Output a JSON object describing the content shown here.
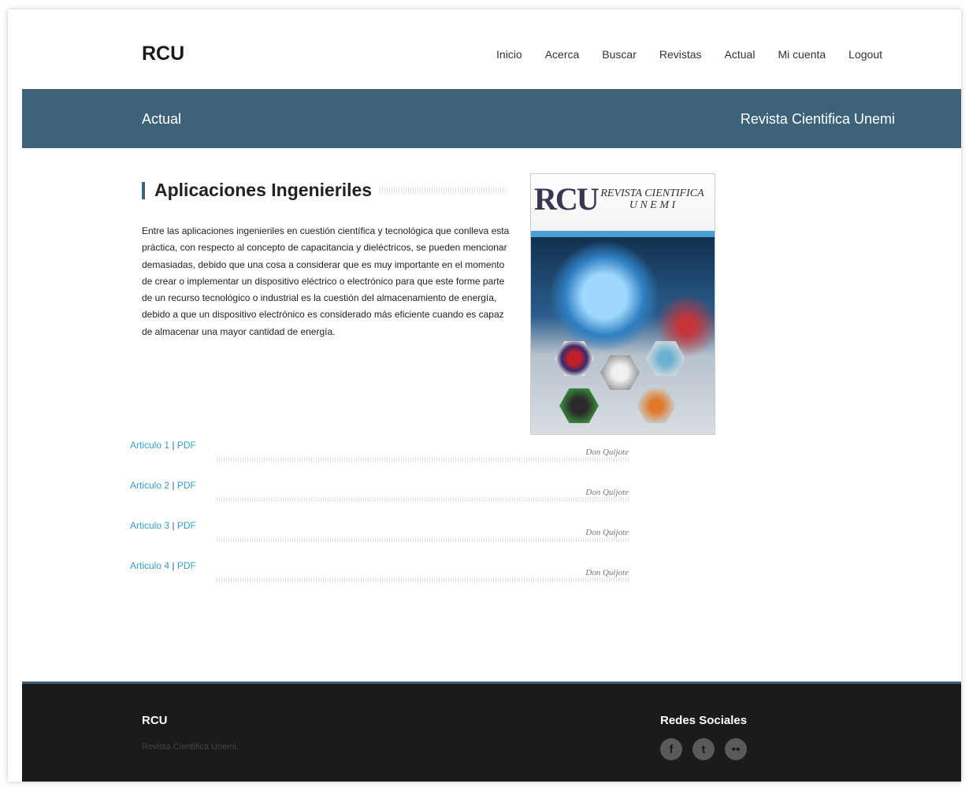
{
  "header": {
    "logo": "RCU",
    "nav": [
      "Inicio",
      "Acerca",
      "Buscar",
      "Revistas",
      "Actual",
      "Mi cuenta",
      "Logout"
    ]
  },
  "banner": {
    "left": "Actual",
    "right": "Revista Cientifica Unemi"
  },
  "article": {
    "heading": "Aplicaciones Ingenieriles",
    "body": "Entre las aplicaciones ingenieriles en cuestión científica y tecnológica que conlleva esta práctica, con respecto al concepto de capacitancia y dieléctricos, se pueden mencionar demasiadas, debido que una cosa a considerar que es muy importante en el momento de crear o implementar un dispositivo eléctrico o electrónico para que este forme parte de un recurso tecnológico o industrial es la cuestión del almacenamiento de energía, debido a que un dispositivo electrónico es considerado más eficiente cuando es capaz de almacenar una mayor cantidad de energía."
  },
  "cover": {
    "logo": "RCU",
    "title_line1": "REVISTA CIENTIFICA",
    "title_line2": "U N E M I"
  },
  "articles": [
    {
      "label": "Articulo 1",
      "sep": "|",
      "pdf": "PDF",
      "author": "Don Quijote"
    },
    {
      "label": "Articulo 2",
      "sep": "|",
      "pdf": "PDF",
      "author": "Don Quijote"
    },
    {
      "label": "Articulo 3",
      "sep": "|",
      "pdf": "PDF",
      "author": "Don Quijote"
    },
    {
      "label": "Articulo 4",
      "sep": "|",
      "pdf": "PDF",
      "author": "Don Quijote"
    }
  ],
  "footer": {
    "title": "RCU",
    "subtitle": "Revista Cientifica Unemi.",
    "social_title": "Redes Sociales",
    "social_icons": [
      {
        "name": "facebook-icon",
        "glyph": "f"
      },
      {
        "name": "twitter-icon",
        "glyph": "t"
      },
      {
        "name": "flickr-icon",
        "glyph": "••"
      }
    ]
  },
  "colors": {
    "banner": "#3e6278",
    "link": "#3a9dc7",
    "footer": "#1b1b1b"
  }
}
